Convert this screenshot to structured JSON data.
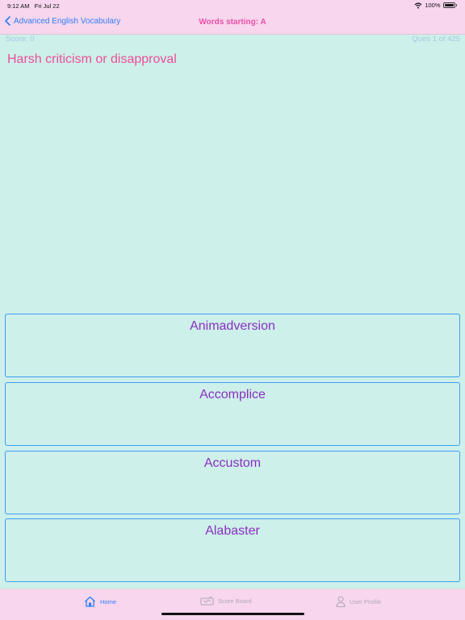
{
  "status_bar": {
    "time": "9:12 AM",
    "date": "Fri Jul 22",
    "battery": "100%"
  },
  "nav": {
    "back_label": "Advanced English Vocabulary",
    "title": "Words starting: A"
  },
  "quiz": {
    "score": "Score: 0",
    "progress": "Ques 1 of 425",
    "question": "Harsh criticism or disapproval",
    "options": [
      "Animadversion",
      "Accomplice",
      "Accustom",
      "Alabaster"
    ]
  },
  "tabbar": {
    "home": "Home",
    "scoreboard": "Score Board",
    "profile": "User Profile"
  },
  "colors": {
    "background": "#cdf0ea",
    "bars": "#f7d6ee",
    "accent": "#2f7ef7",
    "question": "#ec4f92",
    "option_text": "#8b2ec2"
  }
}
